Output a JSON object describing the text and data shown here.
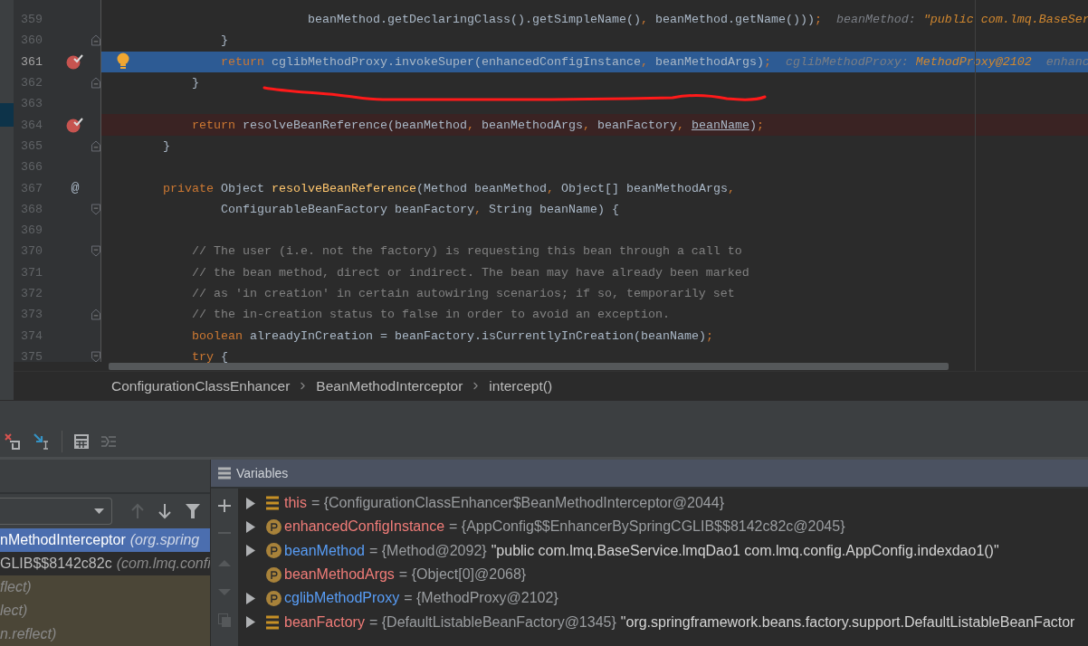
{
  "editor": {
    "lines": [
      {
        "number": "359",
        "breakpoint": false,
        "current": false,
        "intention": false,
        "fold_open": false,
        "fold_close": false,
        "tokens": [
          {
            "kind": "plain",
            "text": "                            beanMethod.getDeclaringClass().getSimpleName()"
          },
          {
            "kind": "punct",
            "text": ","
          },
          {
            "kind": "plain",
            "text": " beanMethod.getName()))"
          },
          {
            "kind": "punct",
            "text": ";"
          },
          {
            "kind": "hint",
            "text": "  beanMethod: "
          },
          {
            "kind": "hintval",
            "text": "\"public com.lmq.BaseSer"
          }
        ]
      },
      {
        "number": "360",
        "breakpoint": false,
        "current": false,
        "intention": false,
        "fold_open": false,
        "fold_close": true,
        "tokens": [
          {
            "kind": "plain",
            "text": "                }"
          }
        ]
      },
      {
        "number": "361",
        "breakpoint": true,
        "current": true,
        "intention": true,
        "fold_open": false,
        "fold_close": false,
        "tokens": [
          {
            "kind": "kw",
            "text": "                return"
          },
          {
            "kind": "plain",
            "text": " cglibMethodProxy.invokeSuper(enhancedConfigInstance"
          },
          {
            "kind": "punct",
            "text": ","
          },
          {
            "kind": "plain",
            "text": " beanMethodArgs)"
          },
          {
            "kind": "punct",
            "text": ";"
          },
          {
            "kind": "hint",
            "text": "  cglibMethodProxy: "
          },
          {
            "kind": "hintval",
            "text": "MethodProxy@2102"
          },
          {
            "kind": "hint",
            "text": "  enhanc"
          }
        ]
      },
      {
        "number": "362",
        "breakpoint": false,
        "current": false,
        "intention": false,
        "fold_open": false,
        "fold_close": true,
        "tokens": [
          {
            "kind": "plain",
            "text": "            }"
          }
        ]
      },
      {
        "number": "363",
        "breakpoint": false,
        "current": false,
        "intention": false,
        "fold_open": false,
        "fold_close": false
      },
      {
        "number": "364",
        "breakpoint": true,
        "current": false,
        "intention": false,
        "fold_open": false,
        "fold_close": false,
        "tokens": [
          {
            "kind": "kw",
            "text": "            return"
          },
          {
            "kind": "plain",
            "text": " resolveBeanReference(beanMethod"
          },
          {
            "kind": "punct",
            "text": ","
          },
          {
            "kind": "plain",
            "text": " beanMethodArgs"
          },
          {
            "kind": "punct",
            "text": ","
          },
          {
            "kind": "plain",
            "text": " beanFactory"
          },
          {
            "kind": "punct",
            "text": ", "
          },
          {
            "kind": "ref",
            "text": "beanName"
          },
          {
            "kind": "plain",
            "text": ")"
          },
          {
            "kind": "punct",
            "text": ";"
          }
        ]
      },
      {
        "number": "365",
        "breakpoint": false,
        "current": false,
        "intention": false,
        "fold_open": false,
        "fold_close": true,
        "tokens": [
          {
            "kind": "plain",
            "text": "        }"
          }
        ]
      },
      {
        "number": "366",
        "breakpoint": false,
        "current": false,
        "intention": false,
        "fold_open": false,
        "fold_close": false
      },
      {
        "number": "367",
        "breakpoint": false,
        "current": false,
        "intention": false,
        "fold_open": false,
        "fold_close": false,
        "gutter_mark": "@",
        "tokens": [
          {
            "kind": "kw",
            "text": "        private"
          },
          {
            "kind": "plain",
            "text": " Object "
          },
          {
            "kind": "decl",
            "text": "resolveBeanReference"
          },
          {
            "kind": "plain",
            "text": "(Method beanMethod"
          },
          {
            "kind": "punct",
            "text": ","
          },
          {
            "kind": "plain",
            "text": " Object[] beanMethodArgs"
          },
          {
            "kind": "punct",
            "text": ","
          }
        ]
      },
      {
        "number": "368",
        "breakpoint": false,
        "current": false,
        "intention": false,
        "fold_open": true,
        "fold_close": false,
        "tokens": [
          {
            "kind": "plain",
            "text": "                ConfigurableBeanFactory beanFactory"
          },
          {
            "kind": "punct",
            "text": ","
          },
          {
            "kind": "plain",
            "text": " String beanName) {"
          }
        ]
      },
      {
        "number": "369",
        "breakpoint": false,
        "current": false,
        "intention": false,
        "fold_open": false,
        "fold_close": false
      },
      {
        "number": "370",
        "breakpoint": false,
        "current": false,
        "intention": false,
        "fold_open": true,
        "fold_close": false,
        "tokens": [
          {
            "kind": "cmt",
            "text": "            // The user (i.e. not the factory) is requesting this bean through a call to"
          }
        ]
      },
      {
        "number": "371",
        "breakpoint": false,
        "current": false,
        "intention": false,
        "fold_open": false,
        "fold_close": false,
        "tokens": [
          {
            "kind": "cmt",
            "text": "            // the bean method, direct or indirect. The bean may have already been marked"
          }
        ]
      },
      {
        "number": "372",
        "breakpoint": false,
        "current": false,
        "intention": false,
        "fold_open": false,
        "fold_close": false,
        "tokens": [
          {
            "kind": "cmt",
            "text": "            // as 'in creation' in certain autowiring scenarios; if so, temporarily set"
          }
        ]
      },
      {
        "number": "373",
        "breakpoint": false,
        "current": false,
        "intention": false,
        "fold_open": false,
        "fold_close": true,
        "tokens": [
          {
            "kind": "cmt",
            "text": "            // the in-creation status to false in order to avoid an exception."
          }
        ]
      },
      {
        "number": "374",
        "breakpoint": false,
        "current": false,
        "intention": false,
        "fold_open": false,
        "fold_close": false,
        "tokens": [
          {
            "kind": "kw",
            "text": "            boolean"
          },
          {
            "kind": "plain",
            "text": " alreadyInCreation = beanFactory.isCurrentlyInCreation(beanName)"
          },
          {
            "kind": "punct",
            "text": ";"
          }
        ]
      },
      {
        "number": "375",
        "breakpoint": false,
        "current": false,
        "intention": false,
        "fold_open": true,
        "fold_close": false,
        "tokens": [
          {
            "kind": "kw",
            "text": "            try"
          },
          {
            "kind": "plain",
            "text": " {"
          }
        ]
      }
    ]
  },
  "breadcrumb": [
    "ConfigurationClassEnhancer",
    "BeanMethodInterceptor",
    "intercept()"
  ],
  "frames": {
    "rows": [
      {
        "method": "nMethodInterceptor",
        "location": "(org.spring",
        "selected": true,
        "library": false
      },
      {
        "method": "GLIB$$8142c82c",
        "location": "(com.lmq.confi",
        "selected": false,
        "library": false
      },
      {
        "location": "flect)",
        "selected": false,
        "library": true
      },
      {
        "location": "lect)",
        "selected": false,
        "library": true
      },
      {
        "location": "n.reflect)",
        "selected": false,
        "library": true
      }
    ]
  },
  "variables": {
    "title": "Variables",
    "rows": [
      {
        "kind": "field",
        "name": "this",
        "expandable": true,
        "color": "#f07c78",
        "value": "= {ConfigurationClassEnhancer$BeanMethodInterceptor@2044}",
        "string_value": false
      },
      {
        "kind": "param",
        "name": "enhancedConfigInstance",
        "expandable": true,
        "color": "#f07c78",
        "value": "= {AppConfig$$EnhancerBySpringCGLIB$$8142c82c@2045}",
        "string_value": false
      },
      {
        "kind": "param",
        "name": "beanMethod",
        "expandable": true,
        "color": "#589df6",
        "value": "= {Method@2092}",
        "string_value": false,
        "detail": "\"public com.lmq.BaseService.lmqDao1 com.lmq.config.AppConfig.indexdao1()\""
      },
      {
        "kind": "param",
        "name": "beanMethodArgs",
        "expandable": false,
        "color": "#f07c78",
        "value": "= {Object[0]@2068}",
        "string_value": false
      },
      {
        "kind": "param",
        "name": "cglibMethodProxy",
        "expandable": true,
        "color": "#589df6",
        "value": "= {MethodProxy@2102}",
        "string_value": false
      },
      {
        "kind": "field",
        "name": "beanFactory",
        "expandable": true,
        "color": "#f07c78",
        "value": "= {DefaultListableBeanFactory@1345}",
        "string_value": false,
        "detail": "\"org.springframework.beans.factory.support.DefaultListableBeanFactor"
      }
    ]
  }
}
